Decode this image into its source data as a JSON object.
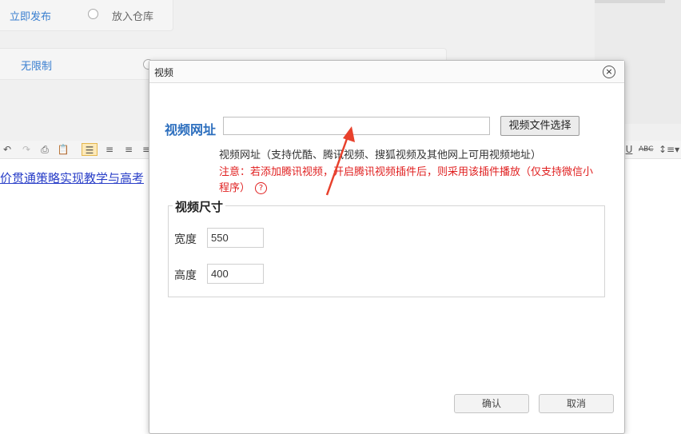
{
  "background": {
    "publish_now": "立即发布",
    "put_in_warehouse": "放入仓库",
    "no_limit": "无限制",
    "editor_text": "价贯通策略实现教学与高考"
  },
  "dialog": {
    "title": "视频",
    "url_label": "视频网址",
    "url_value": "",
    "file_button": "视频文件选择",
    "hint": "视频网址（支持优酷、腾讯视频、搜狐视频及其他网上可用视频地址）",
    "warning": "注意：若添加腾讯视频，开启腾讯视频插件后，则采用该插件播放（仅支持微信小程序）",
    "help_icon_glyph": "?",
    "size_legend": "视频尺寸",
    "width_label": "宽度",
    "width_value": "550",
    "height_label": "高度",
    "height_value": "400",
    "ok_label": "确认",
    "cancel_label": "取消",
    "close_glyph": "×"
  },
  "colors": {
    "accent_blue": "#2d6fbe",
    "warning_red": "#e02020",
    "arrow_red": "#e8412c"
  }
}
